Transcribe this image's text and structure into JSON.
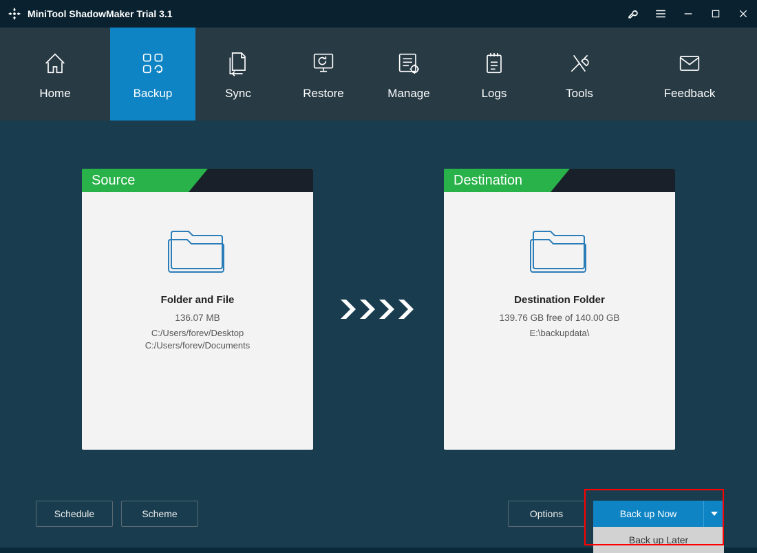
{
  "titlebar": {
    "title": "MiniTool ShadowMaker Trial 3.1"
  },
  "nav": {
    "home": "Home",
    "backup": "Backup",
    "sync": "Sync",
    "restore": "Restore",
    "manage": "Manage",
    "logs": "Logs",
    "tools": "Tools",
    "feedback": "Feedback"
  },
  "source": {
    "header": "Source",
    "title": "Folder and File",
    "size": "136.07 MB",
    "path1": "C:/Users/forev/Desktop",
    "path2": "C:/Users/forev/Documents"
  },
  "destination": {
    "header": "Destination",
    "title": "Destination Folder",
    "free": "139.76 GB free of 140.00 GB",
    "path": "E:\\backupdata\\"
  },
  "buttons": {
    "schedule": "Schedule",
    "scheme": "Scheme",
    "options": "Options",
    "backup_now": "Back up Now",
    "backup_later": "Back up Later"
  }
}
